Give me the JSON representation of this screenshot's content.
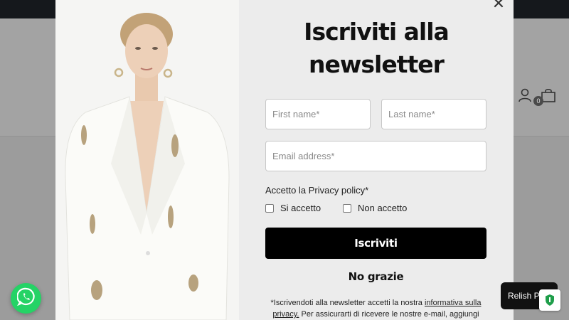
{
  "site": {
    "cart_count": "0"
  },
  "modal": {
    "title_line1": "Iscriviti alla",
    "title_line2": "newsletter",
    "first_name_placeholder": "First name*",
    "last_name_placeholder": "Last name*",
    "email_placeholder": "Email address*",
    "privacy_label": "Accetto la Privacy policy*",
    "privacy_yes": "Si accetto",
    "privacy_no": "Non accetto",
    "submit_label": "Iscriviti",
    "decline_label": "No grazie",
    "disclaimer_before": "*Iscrivendoti alla newsletter accetti la nostra ",
    "disclaimer_link": "informativa sulla privacy.",
    "disclaimer_after": " Per assicurarti di ricevere le nostre e-mail, aggiungi"
  },
  "widgets": {
    "relish_label": "Relish Po"
  },
  "colors": {
    "submit_bg": "#000000",
    "whatsapp": "#25d366",
    "modal_bg": "#ececec",
    "topbar": "#15181c"
  },
  "icons": [
    "close-icon",
    "user-icon",
    "shopping-bag-icon",
    "whatsapp-icon",
    "cookie-shield-icon"
  ]
}
